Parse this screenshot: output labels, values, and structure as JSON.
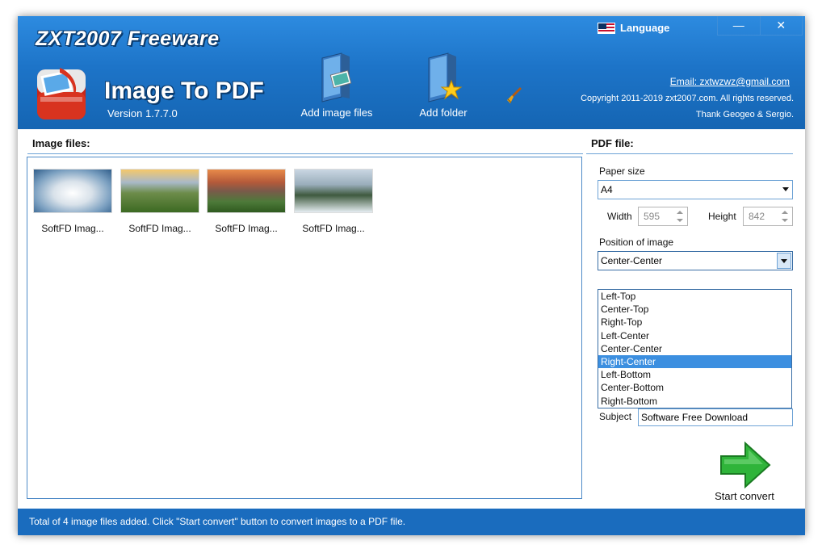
{
  "header": {
    "brand": "ZXT2007 Freeware",
    "app_title": "Image To PDF",
    "version": "Version 1.7.7.0",
    "add_files_label": "Add image files",
    "add_folder_label": "Add folder",
    "language_label": "Language",
    "minimize": "—",
    "close": "✕",
    "email": "Email: zxtwzwz@gmail.com",
    "copyright": "Copyright  2011-2019 zxt2007.com. All rights reserved.",
    "thanks": "Thank Geogeo & Sergio."
  },
  "image_files": {
    "heading": "Image files:",
    "items": [
      {
        "label": "SoftFD Imag..."
      },
      {
        "label": "SoftFD Imag..."
      },
      {
        "label": "SoftFD Imag..."
      },
      {
        "label": "SoftFD Imag..."
      }
    ]
  },
  "pdf_file": {
    "heading": "PDF file:",
    "paper_size_label": "Paper size",
    "paper_size_value": "A4",
    "width_label": "Width",
    "width_value": "595",
    "height_label": "Height",
    "height_value": "842",
    "position_label": "Position of image",
    "position_value": "Center-Center",
    "position_options": [
      "Left-Top",
      "Center-Top",
      "Right-Top",
      "Left-Center",
      "Center-Center",
      "Right-Center",
      "Left-Bottom",
      "Center-Bottom",
      "Right-Bottom"
    ],
    "position_highlighted": "Right-Center",
    "subject_label": "Subject",
    "subject_value": "Software Free Download",
    "start_label": "Start convert"
  },
  "status": {
    "text": "Total of 4 image files added. Click \"Start convert\" button to convert images to a PDF file."
  },
  "colors": {
    "header_blue": "#1d74c8",
    "status_blue": "#1a6cbe",
    "highlight": "#3c8fe0",
    "panel_border": "#4f8bc8"
  }
}
